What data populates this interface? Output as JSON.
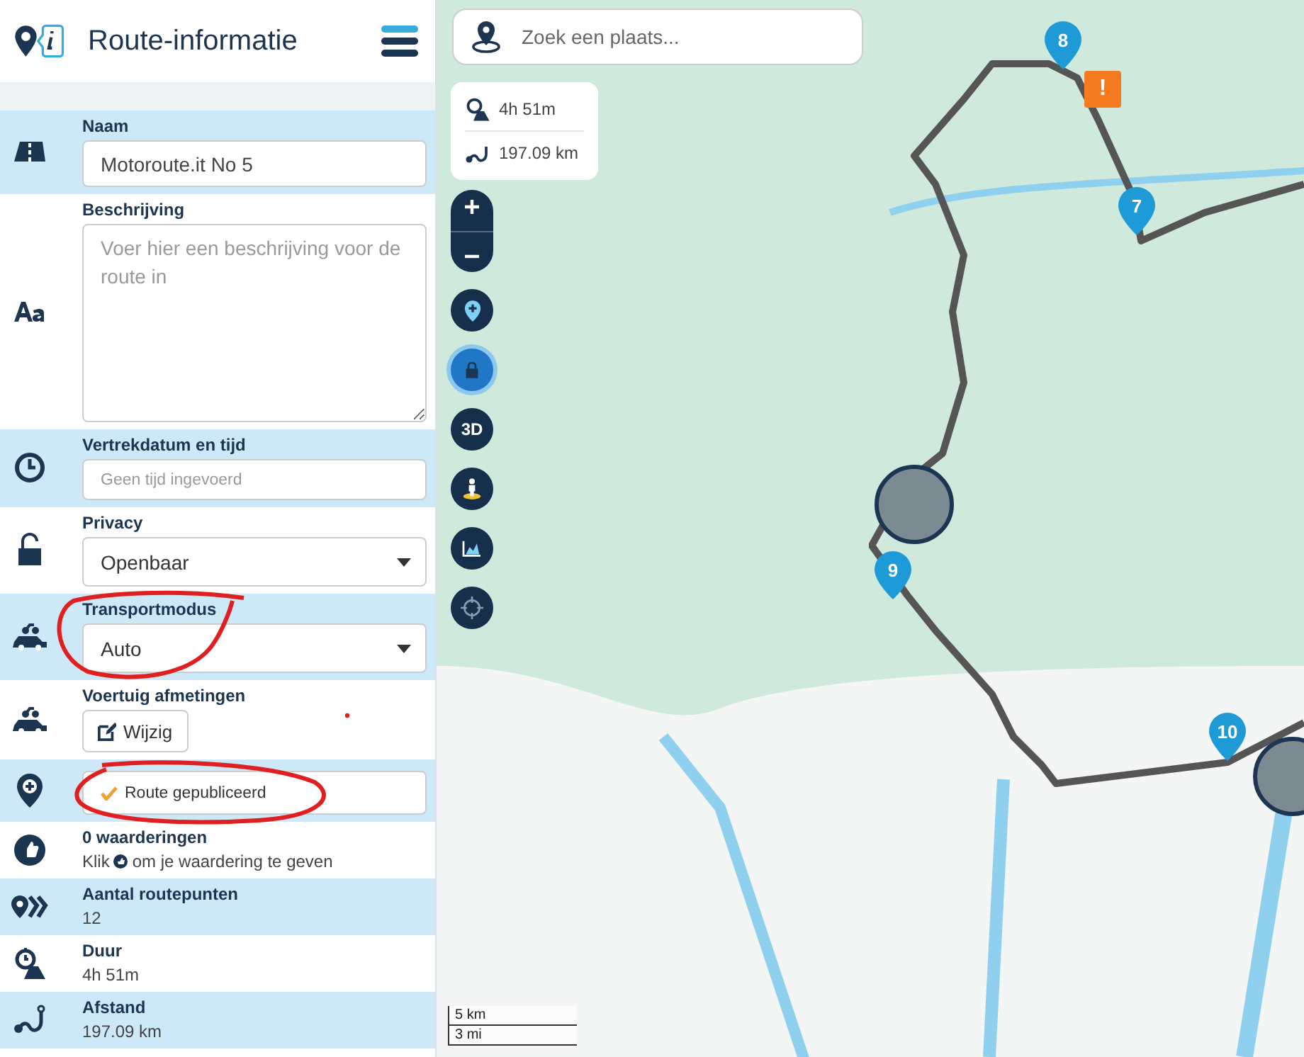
{
  "header": {
    "title": "Route-informatie"
  },
  "rows": [
    {
      "kind": "input",
      "label": "Naam",
      "value": "Motoroute.it No 5"
    },
    {
      "kind": "textarea",
      "label": "Beschrijving",
      "placeholder": "Voer hier een beschrijving voor de route in"
    },
    {
      "kind": "input",
      "label": "Vertrekdatum en tijd",
      "placeholder": "Geen tijd ingevoerd"
    },
    {
      "kind": "select",
      "label": "Privacy",
      "value": "Openbaar"
    },
    {
      "kind": "select",
      "label": "Transportmodus",
      "value": "Auto"
    },
    {
      "kind": "button",
      "label": "Voertuig afmetingen",
      "button": "Wijzig"
    },
    {
      "kind": "status",
      "text": "Route gepubliceerd",
      "checked": true
    },
    {
      "kind": "rating",
      "label": "0 waarderingen",
      "before": "Klik",
      "after": "om je waardering te geven"
    },
    {
      "kind": "info",
      "label": "Aantal routepunten",
      "value": "12"
    },
    {
      "kind": "info",
      "label": "Duur",
      "value": "4h 51m"
    },
    {
      "kind": "info",
      "label": "Afstand",
      "value": "197.09 km"
    }
  ],
  "map": {
    "search": {
      "placeholder": "Zoek een plaats..."
    },
    "summary": {
      "duration": "4h 51m",
      "distance": "197.09 km"
    },
    "controls": [
      {
        "kind": "zoom"
      },
      {
        "kind": "add-point"
      },
      {
        "kind": "lock",
        "active": true
      },
      {
        "kind": "threed",
        "label": "3D"
      },
      {
        "kind": "person"
      },
      {
        "kind": "chart"
      },
      {
        "kind": "locate"
      }
    ],
    "markers": [
      {
        "kind": "pin",
        "label": "8"
      },
      {
        "kind": "warning",
        "label": "!"
      },
      {
        "kind": "pin",
        "label": "7"
      },
      {
        "kind": "photo"
      },
      {
        "kind": "pin",
        "label": "9"
      },
      {
        "kind": "pin",
        "label": "10"
      },
      {
        "kind": "photo"
      }
    ],
    "scale": [
      "5 km",
      "3 mi"
    ]
  }
}
